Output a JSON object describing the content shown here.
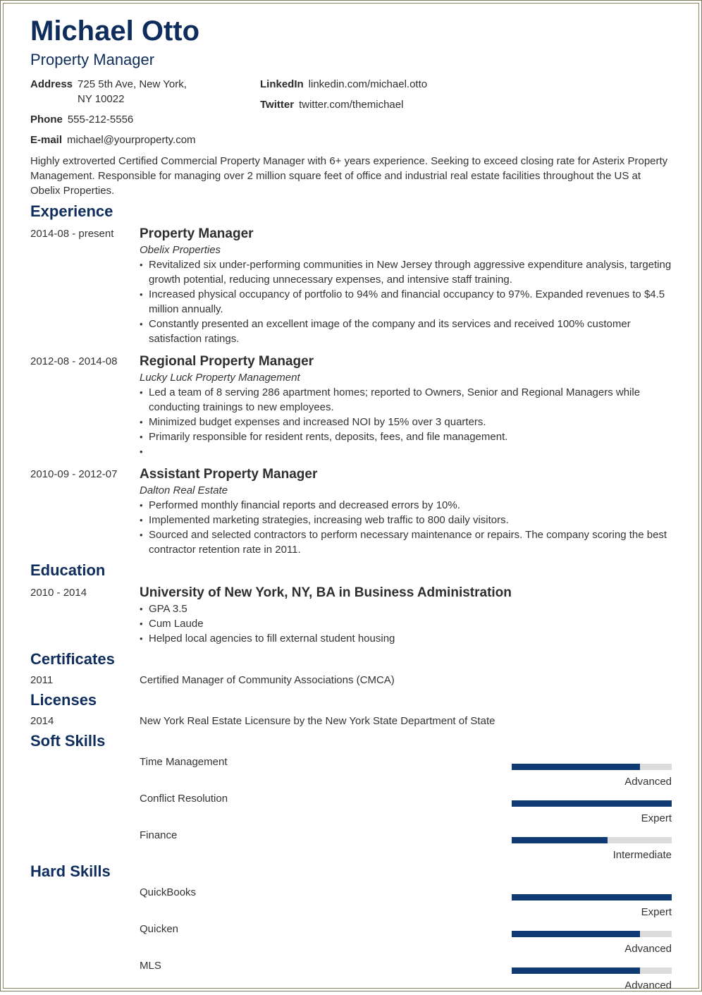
{
  "header": {
    "name": "Michael Otto",
    "title": "Property Manager"
  },
  "contact": {
    "address_label": "Address",
    "address_line1": "725 5th Ave, New York,",
    "address_line2": "NY 10022",
    "phone_label": "Phone",
    "phone": "555-212-5556",
    "email_label": "E-mail",
    "email": "michael@yourproperty.com",
    "linkedin_label": "LinkedIn",
    "linkedin": "linkedin.com/michael.otto",
    "twitter_label": "Twitter",
    "twitter": "twitter.com/themichael"
  },
  "summary": "Highly extroverted Certified Commercial Property Manager with 6+ years experience. Seeking to exceed closing rate for Asterix Property Management. Responsible for managing over 2 million square feet of office and industrial real estate facilities throughout the US at Obelix Properties.",
  "sections": {
    "experience": "Experience",
    "education": "Education",
    "certificates": "Certificates",
    "licenses": "Licenses",
    "soft_skills": "Soft Skills",
    "hard_skills": "Hard Skills"
  },
  "experience": [
    {
      "dates": "2014-08 - present",
      "title": "Property Manager",
      "company": "Obelix Properties",
      "bullets": [
        "Revitalized six under-performing communities in New Jersey through aggressive expenditure analysis, targeting growth potential, reducing unnecessary expenses, and intensive staff training.",
        "Increased physical occupancy of portfolio to 94% and financial occupancy to 97%. Expanded revenues to $4.5 million annually.",
        "Constantly presented an excellent image of the company and its services and received 100% customer satisfaction ratings."
      ]
    },
    {
      "dates": "2012-08 - 2014-08",
      "title": "Regional Property Manager",
      "company": "Lucky Luck Property Management",
      "bullets": [
        "Led a team of 8 serving 286 apartment homes; reported to Owners, Senior and Regional Managers while conducting trainings to new employees.",
        "Minimized budget expenses and increased NOI by 15% over 3 quarters.",
        "Primarily responsible for resident rents, deposits, fees, and file management.",
        ""
      ]
    },
    {
      "dates": "2010-09 - 2012-07",
      "title": "Assistant Property Manager",
      "company": "Dalton Real Estate",
      "bullets": [
        "Performed monthly financial reports and decreased errors by 10%.",
        "Implemented marketing strategies, increasing web traffic to 800 daily visitors.",
        "Sourced and selected contractors to perform necessary maintenance or repairs. The company scoring the best contractor retention rate in 2011."
      ]
    }
  ],
  "education": [
    {
      "dates": "2010 - 2014",
      "title": "University of New York, NY, BA in Business Administration",
      "bullets": [
        "GPA 3.5",
        "Cum Laude",
        "Helped local agencies to fill external student housing"
      ]
    }
  ],
  "certificates": [
    {
      "year": "2011",
      "text": "Certified Manager of Community Associations (CMCA)"
    }
  ],
  "licenses": [
    {
      "year": "2014",
      "text": "New York Real Estate Licensure by the New York State Department of State"
    }
  ],
  "soft_skills": [
    {
      "name": "Time Management",
      "level": "Advanced",
      "fraction": 0.8
    },
    {
      "name": "Conflict Resolution",
      "level": "Expert",
      "fraction": 1.0
    },
    {
      "name": "Finance",
      "level": "Intermediate",
      "fraction": 0.6
    }
  ],
  "hard_skills": [
    {
      "name": "QuickBooks",
      "level": "Expert",
      "fraction": 1.0
    },
    {
      "name": "Quicken",
      "level": "Advanced",
      "fraction": 0.8
    },
    {
      "name": "MLS",
      "level": "Advanced",
      "fraction": 0.8
    }
  ],
  "colors": {
    "heading": "#0f2d5c",
    "bar_fill": "#0f3a73",
    "bar_track": "#dcdcdc",
    "frame": "#7d7c5c"
  }
}
